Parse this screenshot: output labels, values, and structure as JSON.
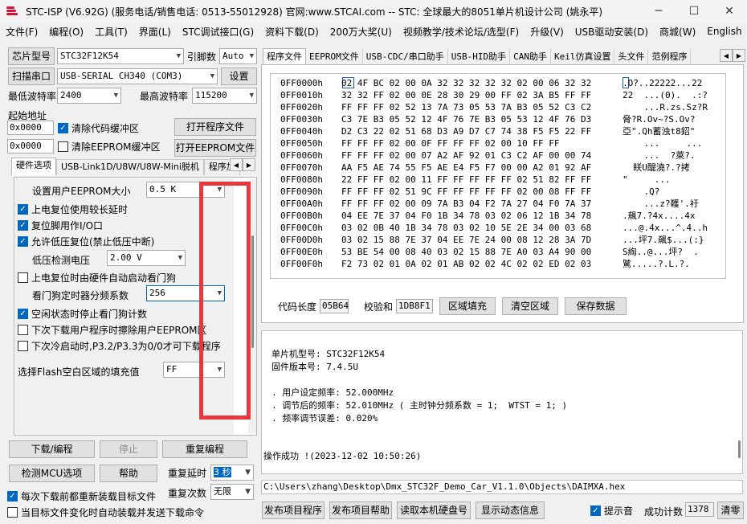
{
  "titlebar": {
    "title": "STC-ISP (V6.92G) (服务电话/销售电话: 0513-55012928) 官网:www.STCAI.com  -- STC: 全球最大的8051单片机设计公司 (姚永平)",
    "minimize": "─",
    "maximize": "☐",
    "close": "✕"
  },
  "menu": [
    "文件(F)",
    "编程(O)",
    "工具(T)",
    "界面(L)",
    "STC调试接口(G)",
    "资料下载(D)",
    "200万大奖(U)",
    "视频教学/技术论坛/选型(F)",
    "升级(V)",
    "USB驱动安装(D)",
    "商城(W)",
    "English"
  ],
  "left": {
    "chip_label": "芯片型号",
    "chip_value": "STC32F12K54",
    "pin_label": "引脚数",
    "pin_value": "Auto",
    "scan_port_label": "扫描串口",
    "port_value": "USB-SERIAL CH340 (COM3)",
    "settings_label": "设置",
    "min_baud_label": "最低波特率",
    "min_baud_value": "2400",
    "max_baud_label": "最高波特率",
    "max_baud_value": "115200",
    "start_addr_label": "起始地址",
    "addr1": "0x0000",
    "clear_code_label": "清除代码缓冲区",
    "open_program_label": "打开程序文件",
    "addr2": "0x0000",
    "clear_eeprom_label": "清除EEPROM缓冲区",
    "open_eeprom_label": "打开EEPROM文件",
    "tabs": [
      "硬件选项",
      "USB-Link1D/U8W/U8W-Mini脱机",
      "程序加"
    ],
    "options": {
      "eeprom_size_label": "设置用户EEPROM大小",
      "eeprom_size_value": "0.5 K",
      "opt_long_delay": "上电复位使用较长延时",
      "opt_reset_io": "复位脚用作I/O口",
      "opt_low_volt_reset": "允许低压复位(禁止低压中断)",
      "low_volt_label": "低压检测电压",
      "low_volt_value": "2.00 V",
      "opt_watchdog_auto": "上电复位时由硬件自动启动看门狗",
      "watchdog_div_label": "看门狗定时器分频系数",
      "watchdog_div_value": "256",
      "opt_idle_stop_wdt": "空闲状态时停止看门狗计数",
      "opt_erase_eeprom": "下次下载用户程序时擦除用户EEPROM区",
      "opt_p32_p33": "下次冷启动时,P3.2/P3.3为0/0才可下载程序",
      "flash_fill_label": "选择Flash空白区域的填充值",
      "flash_fill_value": "FF"
    },
    "download_label": "下载/编程",
    "stop_label": "停止",
    "reprogram_label": "重复编程",
    "check_mcu_label": "检测MCU选项",
    "help_label": "帮助",
    "repeat_delay_label": "重复延时",
    "repeat_delay_value": "3 秒",
    "repeat_count_label": "重复次数",
    "repeat_count_value": "无限",
    "reload_label": "每次下载前都重新装载目标文件",
    "auto_load_label": "当目标文件变化时自动装载并发送下载命令"
  },
  "right": {
    "tabs": [
      "程序文件",
      "EEPROM文件",
      "USB-CDC/串口助手",
      "USB-HID助手",
      "CAN助手",
      "Keil仿真设置",
      "头文件",
      "范例程序"
    ],
    "hex_rows": [
      {
        "addr": "0FF0000h",
        "bytes": "02 4F BC 02 00 0A 32 32 32 32 32 02 00 06 32 32",
        "ascii": ".O?..22222...22"
      },
      {
        "addr": "0FF0010h",
        "bytes": "32 32 FF 02 00 0E 28 30 29 00 FF 02 3A B5 FF FF",
        "ascii": "22  ...(0).  .:?"
      },
      {
        "addr": "0FF0020h",
        "bytes": "FF FF FF 02 52 13 7A 73 05 53 7A B3 05 52 C3 C2",
        "ascii": "    ...R.zs.Sz?R"
      },
      {
        "addr": "0FF0030h",
        "bytes": "C3 7E B3 05 52 12 4F 76 7E B3 05 53 12 4F 76 D3",
        "ascii": "脅?R.Ov~?S.Ov?"
      },
      {
        "addr": "0FF0040h",
        "bytes": "D2 C3 22 02 51 68 D3 A9 D7 C7 74 38 F5 F5 22 FF",
        "ascii": "亞\".Qh蓄浊t8鉊\""
      },
      {
        "addr": "0FF0050h",
        "bytes": "FF FF FF 02 00 0F FF FF FF 02 00 10 FF FF",
        "ascii": "    ...     ..."
      },
      {
        "addr": "0FF0060h",
        "bytes": "FF FF FF 02 00 07 A2 AF 92 01 C3 C2 AF 00 00 74",
        "ascii": "    ...  ?萊?."
      },
      {
        "addr": "0FF0070h",
        "bytes": "AA F5 AE 74 55 F5 AE E4 F5 F7 00 00 A2 01 92 AF",
        "ascii": "  眹U醍澆?.?拷"
      },
      {
        "addr": "0FF0080h",
        "bytes": "22 FF FF 02 00 11 FF FF FF FF FF 02 51 82 FF FF",
        "ascii": "\"     ...     "
      },
      {
        "addr": "0FF0090h",
        "bytes": "FF FF FF 02 51 9C FF FF FF FF FF 02 00 08 FF FF",
        "ascii": "    .Q?      "
      },
      {
        "addr": "0FF00A0h",
        "bytes": "FF FF FF 02 00 09 7A B3 04 F2 7A 27 04 F0 7A 37",
        "ascii": "    ...z?韄'.衧"
      },
      {
        "addr": "0FF00B0h",
        "bytes": "04 EE 7E 37 04 F0 1B 34 78 03 02 06 12 1B 34 78",
        "ascii": ".飆7.?4x....4x"
      },
      {
        "addr": "0FF00C0h",
        "bytes": "03 02 0B 40 1B 34 78 03 02 10 5E 2E 34 00 03 68",
        "ascii": "...@.4x...^.4..h"
      },
      {
        "addr": "0FF00D0h",
        "bytes": "03 02 15 88 7E 37 04 EE 7E 24 00 08 12 28 3A 7D",
        "ascii": "...坪7.飆$...(:}"
      },
      {
        "addr": "0FF00E0h",
        "bytes": "53 BE 54 00 08 40 03 02 15 88 7E A0 03 A4 90 00",
        "ascii": "S綯..@...坪?  ."
      },
      {
        "addr": "0FF00F0h",
        "bytes": "F2 73 02 01 0A 02 01 AB 02 02 4C 02 02 ED 02 03",
        "ascii": "騭.....?.L.?."
      }
    ],
    "code_len_label": "代码长度",
    "code_len_value": "05B64",
    "checksum_label": "校验和",
    "checksum_value": "1DB8F1",
    "fill_region_label": "区域填充",
    "clear_region_label": "清空区域",
    "save_data_label": "保存数据",
    "log": {
      "chip_line": "单片机型号: STC32F12K54",
      "fw_line": "固件版本号: 7.4.5U",
      "freq_set_line": ". 用户设定频率: 52.000MHz",
      "freq_adj_line": ". 调节后的频率: 52.010MHz ( 主时钟分频系数 = 1;  WTST = 1; )",
      "freq_err_line": ". 频率调节误差: 0.020%",
      "success_line": "操作成功 !(2023-12-02 10:50:26)"
    },
    "path": "C:\\Users\\zhang\\Desktop\\Dmx_STC32F_Demo_Car_V1.1.0\\Objects\\DAIMXA.hex",
    "publish_program_label": "发布项目程序",
    "publish_help_label": "发布项目帮助",
    "read_disk_label": "读取本机硬盘号",
    "show_dynamic_label": "显示动态信息",
    "beep_label": "提示音",
    "success_count_label": "成功计数",
    "success_count_value": "1378",
    "clear_label": "清零"
  }
}
